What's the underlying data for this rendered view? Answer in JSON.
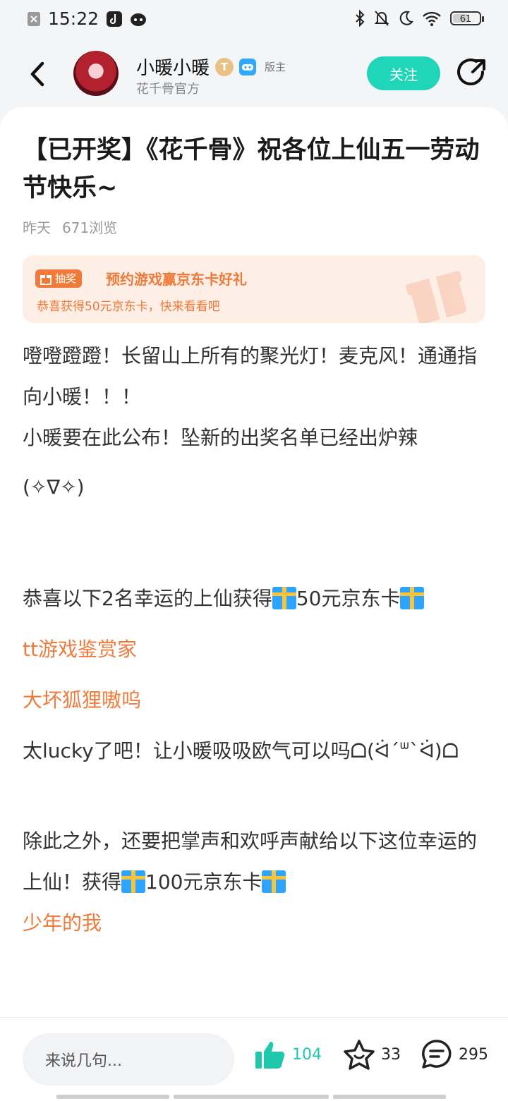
{
  "status_bar": {
    "time": "15:22",
    "battery": "61",
    "battery_level": 0.61
  },
  "header": {
    "author_name": "小暖小暖",
    "level_badge": "T",
    "role": "版主",
    "subtitle": "花千骨官方",
    "follow_label": "关注"
  },
  "post": {
    "title": "【已开奖】《花千骨》祝各位上仙五一劳动节快乐~",
    "date": "昨天",
    "views": "671浏览",
    "lottery": {
      "tag": "抽奖",
      "title": "预约游戏赢京东卡好礼",
      "subtitle": "恭喜获得50元京东卡，快来看看吧"
    },
    "lines": {
      "l1": "噔噔蹬蹬！长留山上所有的聚光灯！麦克风！通通指向小暖！！！",
      "l2": "小暖要在此公布！坠新的出奖名单已经出炉辣",
      "l3": "(✧∇✧)",
      "l4a": "恭喜以下2名幸运的上仙获得",
      "l4b": "50元京东卡",
      "winner1": "tt游戏鉴赏家",
      "winner2": "大坏狐狸嗷呜",
      "l5": "太lucky了吧！让小暖吸吸欧气可以吗ᗝ(ᐛ´ᐜ`ᐛ)ᗝ",
      "l6a": "除此之外，还要把掌声和欢呼声献给以下这位幸运的上仙！获得",
      "l6b": "100元京东卡",
      "winner3": "少年的我"
    }
  },
  "bottom_bar": {
    "comment_placeholder": "来说几句...",
    "likes": "104",
    "favorites": "33",
    "comments": "295"
  },
  "colors": {
    "accent": "#1fd6b8",
    "orange": "#f07a3a",
    "like": "#1fc8ad"
  }
}
